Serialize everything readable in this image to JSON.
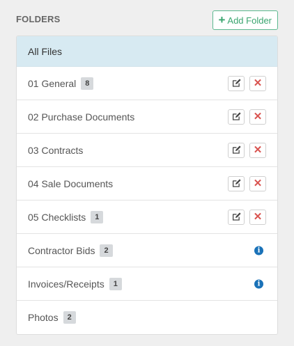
{
  "header": {
    "title": "FOLDERS",
    "add_button_label": "Add Folder"
  },
  "list": {
    "all_files_label": "All Files",
    "folders": [
      {
        "name": "01 General",
        "count": "8",
        "editable": true,
        "info": false
      },
      {
        "name": "02 Purchase Documents",
        "count": "",
        "editable": true,
        "info": false
      },
      {
        "name": "03 Contracts",
        "count": "",
        "editable": true,
        "info": false
      },
      {
        "name": "04 Sale Documents",
        "count": "",
        "editable": true,
        "info": false
      },
      {
        "name": "05 Checklists",
        "count": "1",
        "editable": true,
        "info": false
      },
      {
        "name": "Contractor Bids",
        "count": "2",
        "editable": false,
        "info": true
      },
      {
        "name": "Invoices/Receipts",
        "count": "1",
        "editable": false,
        "info": true
      },
      {
        "name": "Photos",
        "count": "2",
        "editable": false,
        "info": false
      }
    ]
  },
  "icons": {
    "add": "plus-icon",
    "edit": "edit-icon",
    "delete": "close-icon",
    "info": "info-icon"
  },
  "colors": {
    "accent_green": "#3aa56f",
    "selected_row": "#d7eaf2",
    "delete_red": "#d9534f",
    "info_blue": "#1a72b8"
  }
}
